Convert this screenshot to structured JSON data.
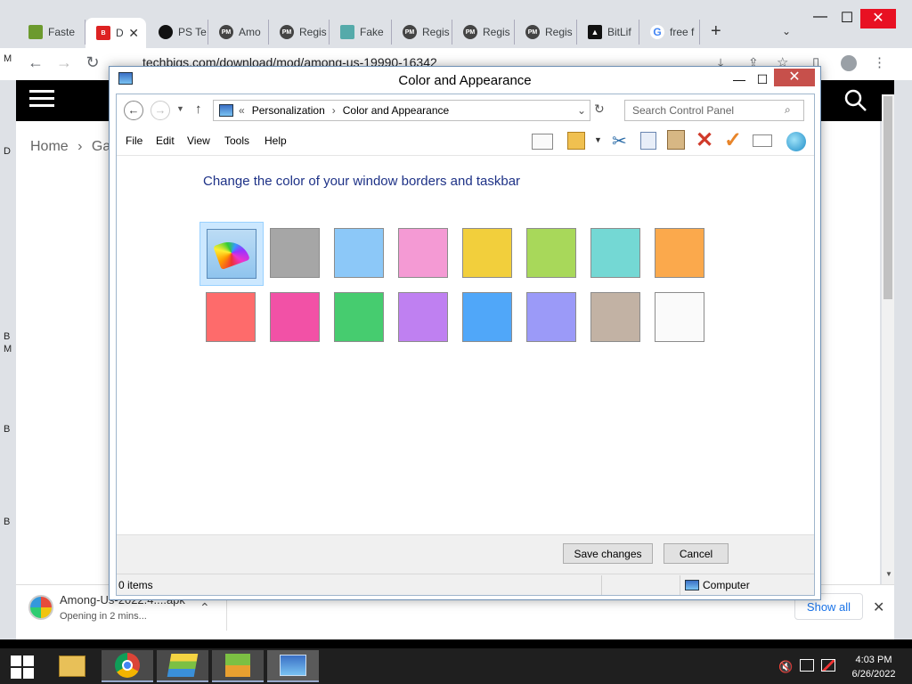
{
  "browser": {
    "tabs": [
      {
        "label": "Faste",
        "fav": ""
      },
      {
        "label": "D",
        "fav": "B"
      },
      {
        "label": "PS Te",
        "fav": ""
      },
      {
        "label": "Amo",
        "fav": "PM"
      },
      {
        "label": "Regis",
        "fav": "PM"
      },
      {
        "label": "Fake",
        "fav": ""
      },
      {
        "label": "Regis",
        "fav": "PM"
      },
      {
        "label": "Regis",
        "fav": "PM"
      },
      {
        "label": "Regis",
        "fav": "PM"
      },
      {
        "label": "BitLif",
        "fav": ""
      },
      {
        "label": "free f",
        "fav": "G"
      }
    ],
    "url": "techbigs.com/download/mod/among-us-19990-16342",
    "breadcrumb_home": "Home",
    "breadcrumb_next": "Ga",
    "side_letters": [
      "M",
      "D",
      "B",
      "M",
      "B",
      "B"
    ],
    "download": {
      "filename": "Among-Us-2022.4....apk",
      "status": "Opening in 2 mins...",
      "show_all": "Show all"
    }
  },
  "window": {
    "title": "Color and Appearance",
    "breadcrumb": {
      "sep": "«",
      "items": [
        "Personalization",
        "Color and Appearance"
      ]
    },
    "search_placeholder": "Search Control Panel",
    "menu": [
      "File",
      "Edit",
      "View",
      "Tools",
      "Help"
    ],
    "heading": "Change the color of your window borders and taskbar",
    "colors_row1": [
      "custom",
      "#a6a6a6",
      "#8cc8f8",
      "#f49ad4",
      "#f2cf3c",
      "#a8d85a",
      "#74d8d4",
      "#fba94c"
    ],
    "colors_row2": [
      "#fe6b6b",
      "#f251a6",
      "#46cc6f",
      "#bf80f1",
      "#50a7f9",
      "#9b9af8",
      "#c2b2a4",
      "#fafafa"
    ],
    "save_label": "Save changes",
    "cancel_label": "Cancel",
    "status_items": "0 items",
    "status_location": "Computer"
  },
  "taskbar": {
    "time": "4:03 PM",
    "date": "6/26/2022"
  }
}
